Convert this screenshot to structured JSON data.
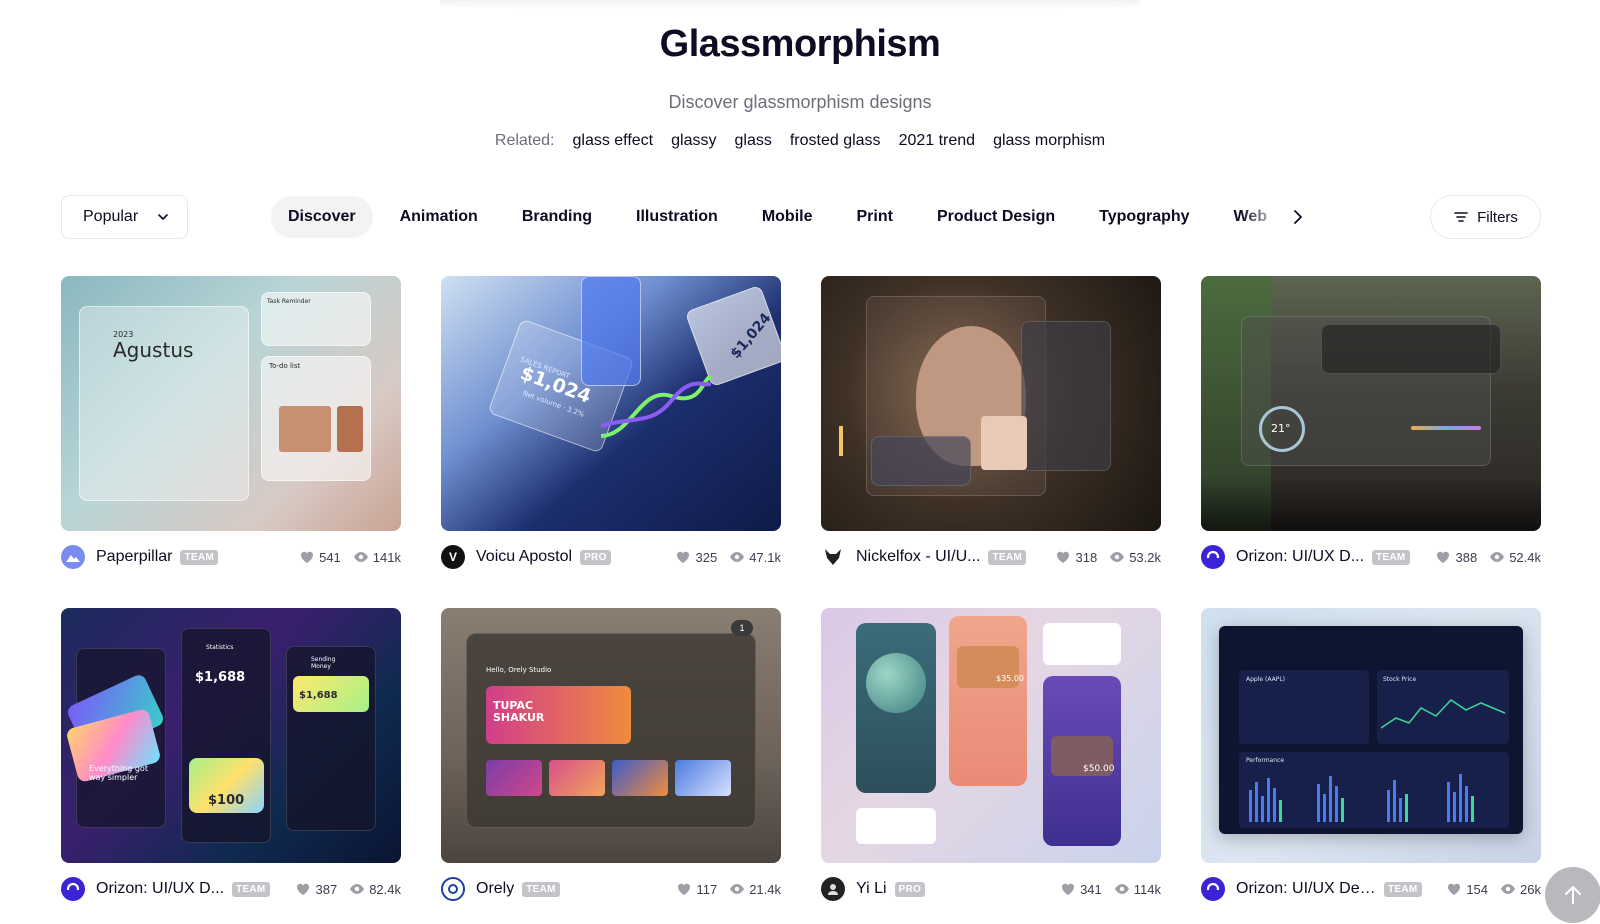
{
  "header": {
    "title": "Glassmorphism",
    "subtitle": "Discover glassmorphism designs",
    "related_label": "Related:",
    "related_tags": [
      "glass effect",
      "glassy",
      "glass",
      "frosted glass",
      "2021 trend",
      "glass morphism"
    ]
  },
  "sort": {
    "selected": "Popular"
  },
  "categories": [
    "Discover",
    "Animation",
    "Branding",
    "Illustration",
    "Mobile",
    "Print",
    "Product Design",
    "Typography",
    "Web De"
  ],
  "active_category": "Discover",
  "filters_label": "Filters",
  "shots": [
    {
      "author": "Paperpillar",
      "badge": "TEAM",
      "likes": "541",
      "views": "141k",
      "avatar_color": "#7b8cf0",
      "art": {
        "title": "Agustus",
        "year": "2023",
        "task": "Task Reminder",
        "todo": "To-do list"
      }
    },
    {
      "author": "Voicu Apostol",
      "badge": "PRO",
      "likes": "325",
      "views": "47.1k",
      "avatar_color": "#111111",
      "art": {
        "label": "SALES REPORT",
        "value": "$1,024",
        "sub": "Net volume · 3.2%",
        "value2": "$1,024"
      }
    },
    {
      "author": "Nickelfox - UI/U...",
      "badge": "TEAM",
      "likes": "318",
      "views": "53.2k",
      "avatar_color": "#ffffff",
      "art": {
        "temp": ""
      }
    },
    {
      "author": "Orizon: UI/UX D...",
      "badge": "TEAM",
      "likes": "388",
      "views": "52.4k",
      "avatar_color": "#3b24d6",
      "art": {
        "temp": "21°"
      }
    },
    {
      "author": "Orizon: UI/UX D...",
      "badge": "TEAM",
      "likes": "387",
      "views": "82.4k",
      "avatar_color": "#3b24d6",
      "art": {
        "stat": "Statistics",
        "amount": "$1,688",
        "amount2": "$1,688",
        "payment": "$100",
        "caption": "Everything got way simpler",
        "sending": "Sending Money"
      }
    },
    {
      "author": "Orely",
      "badge": "TEAM",
      "likes": "117",
      "views": "21.4k",
      "avatar_color": "#1d3fa8",
      "art": {
        "greeting": "Hello, Orely Studio",
        "banner": "TUPAC SHAKUR",
        "count": "1"
      }
    },
    {
      "author": "Yi Li",
      "badge": "PRO",
      "likes": "341",
      "views": "114k",
      "avatar_color": "#222222",
      "art": {
        "price": "$50.00",
        "price2": "$35.00"
      }
    },
    {
      "author": "Orizon: UI/UX Des...",
      "badge": "TEAM",
      "likes": "154",
      "views": "26k",
      "avatar_color": "#3b24d6",
      "art": {
        "ticker": "Apple (AAPL)",
        "panel": "Stock Price",
        "perf": "Performance"
      }
    }
  ]
}
